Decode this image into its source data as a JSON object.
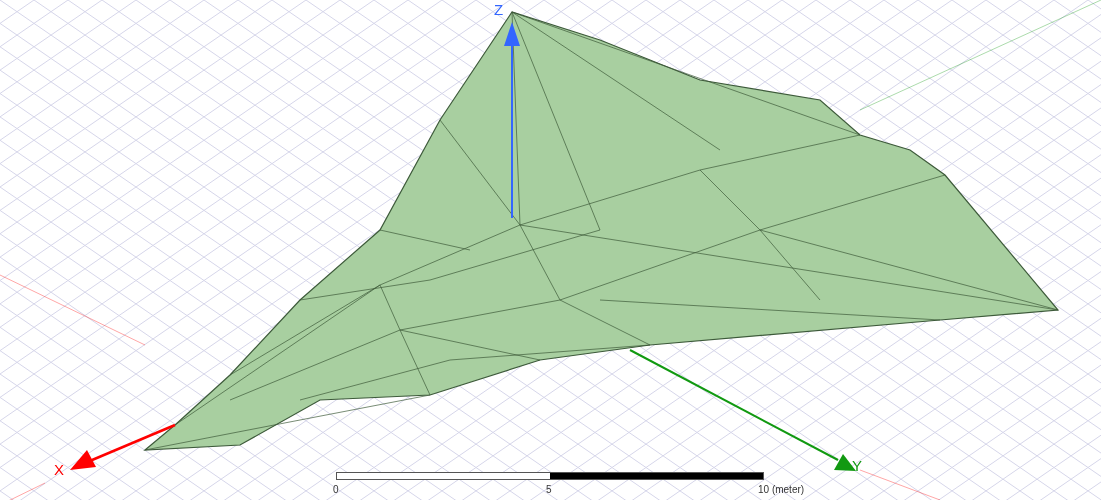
{
  "axes": [
    {
      "label": "X",
      "color": "#ff0000"
    },
    {
      "label": "Y",
      "color": "#119911"
    },
    {
      "label": "Z",
      "color": "#3366ff"
    }
  ],
  "scale_bar": {
    "labels": [
      "0",
      "5",
      "10 (meter)"
    ]
  }
}
